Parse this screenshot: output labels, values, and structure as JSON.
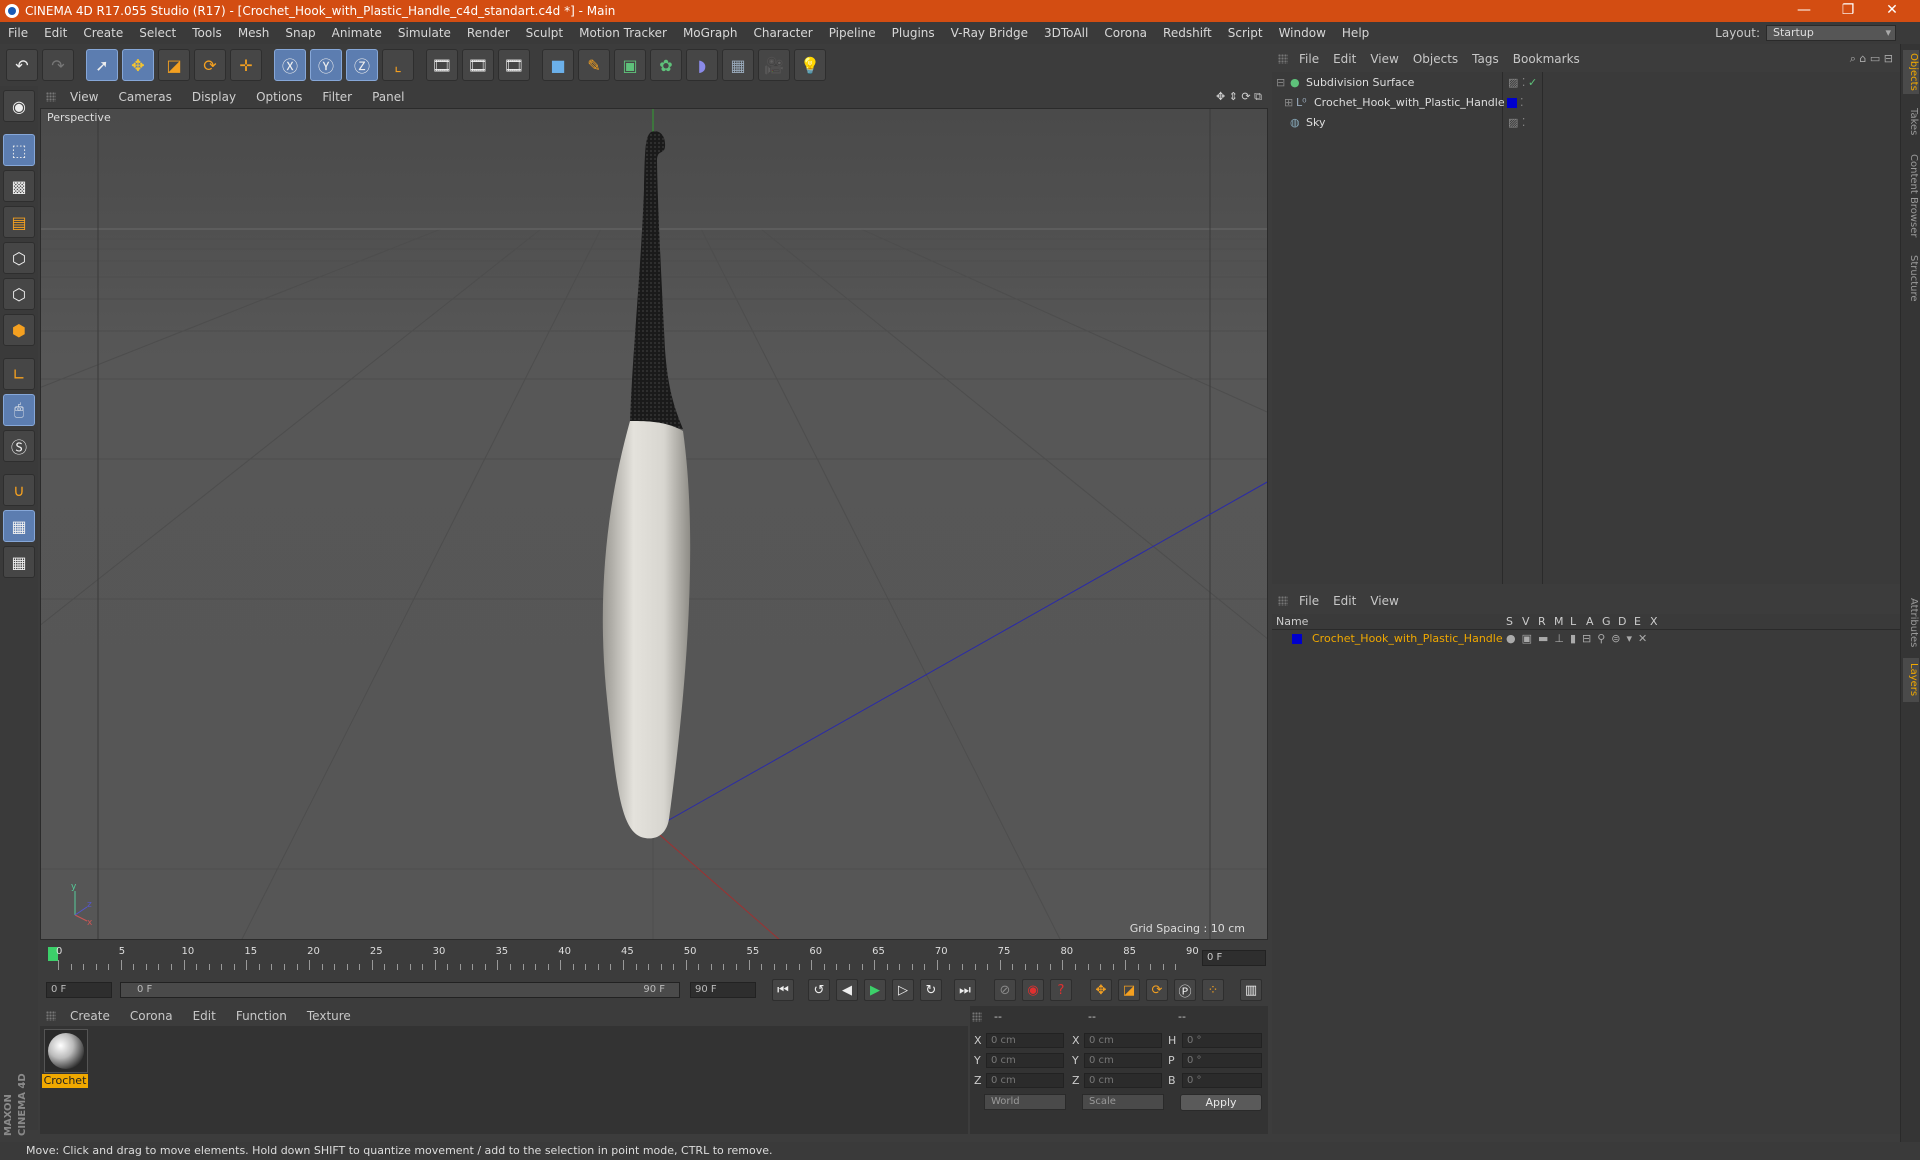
{
  "window": {
    "title": "CINEMA 4D R17.055 Studio (R17) - [Crochet_Hook_with_Plastic_Handle_c4d_standart.c4d *] - Main",
    "controls": [
      "—",
      "❐",
      "✕"
    ]
  },
  "menubar": {
    "items": [
      "File",
      "Edit",
      "Create",
      "Select",
      "Tools",
      "Mesh",
      "Snap",
      "Animate",
      "Simulate",
      "Render",
      "Sculpt",
      "Motion Tracker",
      "MoGraph",
      "Character",
      "Pipeline",
      "Plugins",
      "V-Ray Bridge",
      "3DToAll",
      "Corona",
      "Redshift",
      "Script",
      "Window",
      "Help"
    ],
    "layout_label": "Layout:",
    "layout_value": "Startup"
  },
  "viewport": {
    "menu": [
      "View",
      "Cameras",
      "Display",
      "Options",
      "Filter",
      "Panel"
    ],
    "label": "Perspective",
    "grid_spacing": "Grid Spacing : 10 cm"
  },
  "timeline": {
    "ticks": [
      "0",
      "5",
      "10",
      "15",
      "20",
      "25",
      "30",
      "35",
      "40",
      "45",
      "50",
      "55",
      "60",
      "65",
      "70",
      "75",
      "80",
      "85",
      "90"
    ],
    "current_frame": "0 F"
  },
  "playback": {
    "start": "0 F",
    "range_start": "0 F",
    "range_end": "90 F",
    "end": "90 F"
  },
  "material_manager": {
    "menu": [
      "Create",
      "Corona",
      "Edit",
      "Function",
      "Texture"
    ],
    "materials": [
      {
        "name": "Crochet"
      }
    ]
  },
  "coordinates": {
    "headers": [
      "--",
      "--",
      "--"
    ],
    "rows": [
      {
        "a": "X",
        "av": "0 cm",
        "b": "X",
        "bv": "0 cm",
        "c": "H",
        "cv": "0 °"
      },
      {
        "a": "Y",
        "av": "0 cm",
        "b": "Y",
        "bv": "0 cm",
        "c": "P",
        "cv": "0 °"
      },
      {
        "a": "Z",
        "av": "0 cm",
        "b": "Z",
        "bv": "0 cm",
        "c": "B",
        "cv": "0 °"
      }
    ],
    "space": "World",
    "mode": "Scale",
    "apply": "Apply"
  },
  "object_manager": {
    "menu": [
      "File",
      "Edit",
      "View",
      "Objects",
      "Tags",
      "Bookmarks"
    ],
    "objects": [
      {
        "name": "Subdivision Surface"
      },
      {
        "name": "Crochet_Hook_with_Plastic_Handle"
      },
      {
        "name": "Sky"
      }
    ]
  },
  "layer_manager": {
    "menu": [
      "File",
      "Edit",
      "View"
    ],
    "columns": [
      "Name",
      "S",
      "V",
      "R",
      "M",
      "L",
      "A",
      "G",
      "D",
      "E",
      "X"
    ],
    "layers": [
      {
        "name": "Crochet_Hook_with_Plastic_Handle",
        "color": "#0000cc"
      }
    ]
  },
  "right_tabs": [
    "Objects",
    "Takes",
    "Content Browser",
    "Structure",
    "Attributes",
    "Layers"
  ],
  "status": "Move: Click and drag to move elements. Hold down SHIFT to quantize movement / add to the selection in point mode, CTRL to remove.",
  "brand": "MAXON CINEMA 4D",
  "colors": {
    "title": "#d34d12",
    "accent": "#5c7db0",
    "selected_text": "#f0a800"
  }
}
